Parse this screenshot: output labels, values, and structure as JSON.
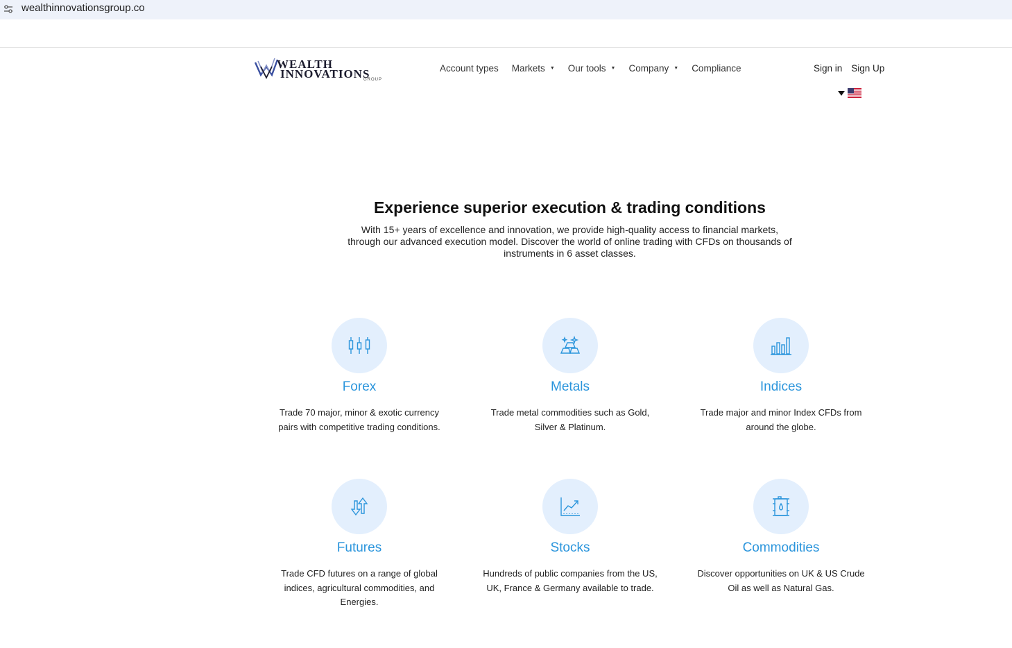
{
  "browser": {
    "url": "wealthinnovationsgroup.co"
  },
  "logo": {
    "line1": "WEALTH",
    "line2": "INNOVATIONS",
    "line3": "GROUP"
  },
  "nav": {
    "items": [
      {
        "label": "Account types",
        "has_dropdown": false
      },
      {
        "label": "Markets",
        "has_dropdown": true
      },
      {
        "label": "Our tools",
        "has_dropdown": true
      },
      {
        "label": "Company",
        "has_dropdown": true
      },
      {
        "label": "Compliance",
        "has_dropdown": false
      }
    ],
    "sign_in": "Sign in",
    "sign_up": "Sign Up",
    "language_icon": "us-flag-icon"
  },
  "hero": {
    "title": "Experience superior execution & trading conditions",
    "text": "With 15+ years of excellence and innovation, we provide high-quality access to financial markets, through our advanced execution model. Discover the world of online trading with CFDs on thousands of instruments in 6 asset classes."
  },
  "markets": [
    {
      "name": "Forex",
      "icon": "candlestick-icon",
      "desc": "Trade 70 major, minor & exotic currency pairs with competitive trading conditions."
    },
    {
      "name": "Metals",
      "icon": "gold-bars-icon",
      "desc": "Trade metal commodities such as Gold, Silver & Platinum."
    },
    {
      "name": "Indices",
      "icon": "bar-chart-icon",
      "desc": "Trade major and minor Index CFDs from around the globe."
    },
    {
      "name": "Futures",
      "icon": "up-down-arrows-icon",
      "desc": "Trade CFD futures on a range of global indices, agricultural commodities, and Energies."
    },
    {
      "name": "Stocks",
      "icon": "line-chart-icon",
      "desc": "Hundreds of public companies from the US, UK, France & Germany available to trade."
    },
    {
      "name": "Commodities",
      "icon": "oil-barrel-icon",
      "desc": "Discover opportunities on UK & US Crude Oil as well as Natural Gas."
    }
  ],
  "colors": {
    "accent": "#2b95dc",
    "icon_bg": "#e3effd",
    "url_bar": "#eef2fa"
  }
}
